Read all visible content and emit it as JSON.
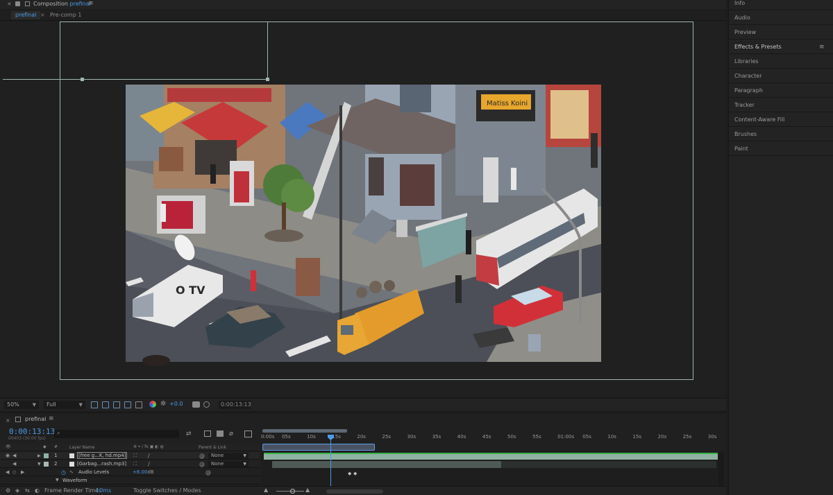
{
  "composition": {
    "prefix": "Composition",
    "name": "prefinal",
    "close": "×",
    "menu": "≡"
  },
  "comp_tabs": [
    {
      "label": "prefinal",
      "close": "×"
    },
    {
      "label": "Pre-comp 1"
    }
  ],
  "viewer": {
    "zoom": "50%",
    "resolution": "Full",
    "exposure": "+0.0",
    "timecode": "0:00:13:13",
    "footage_labels": {
      "store_sign": "Matiss Koini",
      "van_logo": "O TV"
    }
  },
  "right_panel": {
    "items": [
      "Info",
      "Audio",
      "Preview",
      "Effects & Presets",
      "Libraries",
      "Character",
      "Paragraph",
      "Tracker",
      "Content-Aware Fill",
      "Brushes",
      "Paint"
    ],
    "menu": "≡"
  },
  "timeline": {
    "tab_close": "×",
    "tab_name": "prefinal",
    "tab_menu": "≡",
    "current_time": "0:00:13:13",
    "frames": "00403 (30.00 fps)",
    "search_icon": "⌕",
    "header": {
      "hash": "#",
      "layer_name": "Layer Name",
      "parent": "Parent & Link"
    },
    "layers": [
      {
        "num": "1",
        "name": "[free g...K, hd.mp4]",
        "parent": "None",
        "color": "#8fb2a3"
      },
      {
        "num": "2",
        "name": "[Garbag...rash.mp3]",
        "parent": "None",
        "color": "#aab8b2"
      }
    ],
    "audio_levels": {
      "label": "Audio Levels",
      "value": "+6.00",
      "unit": "dB"
    },
    "waveform": "Waveform",
    "ruler_ticks": [
      "0:00s",
      "05s",
      "10s",
      "15s",
      "20s",
      "25s",
      "30s",
      "35s",
      "40s",
      "45s",
      "50s",
      "55s",
      "01:00s",
      "05s",
      "10s",
      "15s",
      "20s",
      "25s",
      "30s"
    ],
    "footer": {
      "render_label": "Frame Render Time:",
      "render_value": "10ms",
      "toggle": "Toggle Switches / Modes"
    }
  },
  "colors": {
    "accent": "#4a9be8",
    "panel": "#232323",
    "track": "#8fb2a3"
  }
}
